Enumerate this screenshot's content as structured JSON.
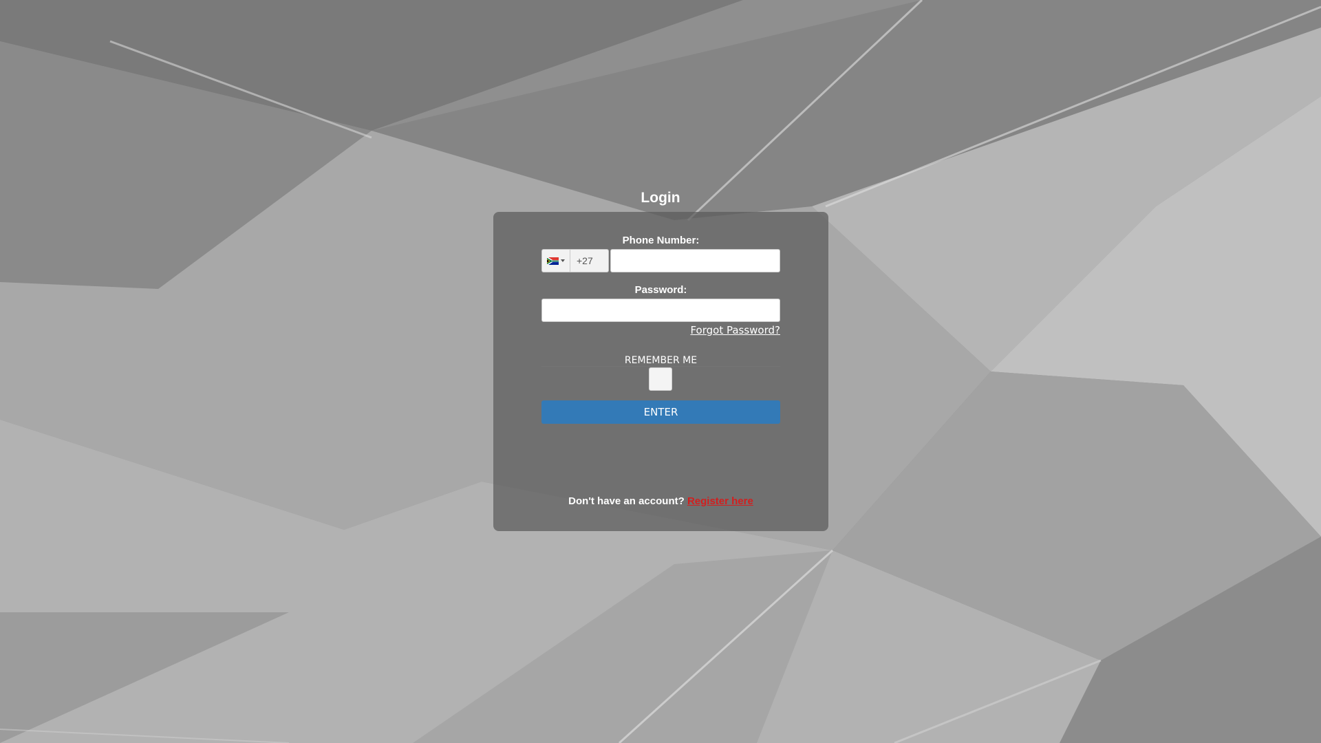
{
  "page": {
    "title": "Login"
  },
  "form": {
    "phone_label": "Phone Number:",
    "country_flag": "south-africa-flag-icon",
    "dial_code": "+27",
    "phone_value": "",
    "password_label": "Password:",
    "password_value": "",
    "forgot_password": "Forgot Password?",
    "remember_me": "REMEMBER ME",
    "remember_checked": false,
    "enter_label": "ENTER"
  },
  "footer": {
    "no_account_text": "Don't have an account?",
    "register_link": "Register here"
  },
  "colors": {
    "background": "#9a9a9a",
    "panel": "#5a5a5a",
    "enter_button": "#337ab7",
    "register_link": "#d21f1f"
  }
}
